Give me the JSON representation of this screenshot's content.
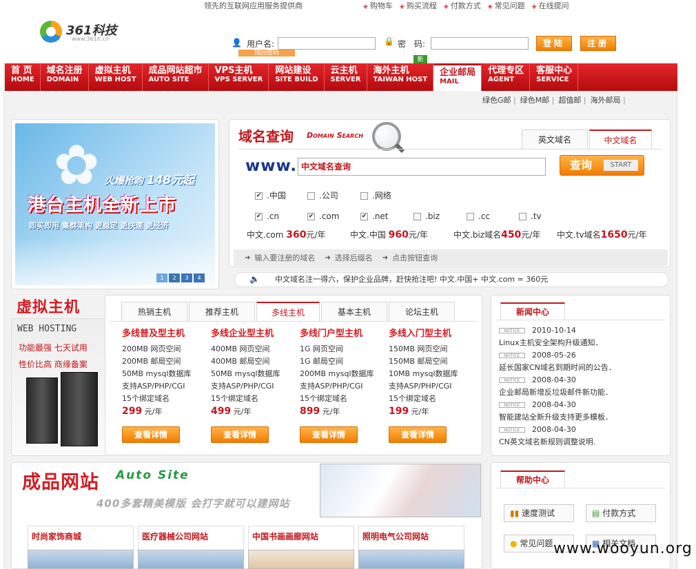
{
  "header": {
    "slogan": "领先的互联网应用服务提供商",
    "top_links": [
      "购物车",
      "购买流程",
      "付款方式",
      "常见问题",
      "在线提问"
    ],
    "logo_text": "361科技",
    "logo_sub": "www.361it.cn"
  },
  "login": {
    "username_label": "用户名:",
    "password_label": "密　码:",
    "login_button": "登陆",
    "register_button": "注册",
    "forgot_link": "找回密码",
    "new_badge": "新"
  },
  "nav": [
    {
      "cn": "首 页",
      "en": "HOME"
    },
    {
      "cn": "域名注册",
      "en": "DOMAIN"
    },
    {
      "cn": "虚拟主机",
      "en": "WEB HOST"
    },
    {
      "cn": "成品网站超市",
      "en": "AUTO SITE"
    },
    {
      "cn": "VPS主机",
      "en": "VPS SERVER"
    },
    {
      "cn": "网站建设",
      "en": "SITE BUILD"
    },
    {
      "cn": "云主机",
      "en": "SERVER"
    },
    {
      "cn": "海外主机",
      "en": "TAIWAN HOST"
    },
    {
      "cn": "企业邮局",
      "en": "MAIL"
    },
    {
      "cn": "代理专区",
      "en": "AGENT"
    },
    {
      "cn": "客服中心",
      "en": "SERVICE"
    }
  ],
  "subnav": [
    "绿色G邮",
    "绿色M邮",
    "超值邮",
    "海外邮局"
  ],
  "banner": {
    "promo": "火爆抢购",
    "price": "148元起",
    "headline": "港台主机全新上市",
    "tagline": "即买即用 集群架构 更稳定 更快速 更经济",
    "pages": [
      "1",
      "2",
      "3",
      "4"
    ]
  },
  "domain_search": {
    "title": "域名查询",
    "title_en": "Domain Search",
    "tabs": [
      "英文域名",
      "中文域名"
    ],
    "prefix": "www.",
    "input_value": "中文域名查询",
    "query_button": "查询",
    "start_label": "START",
    "row1": [
      {
        "label": ".中国",
        "checked": true
      },
      {
        "label": ".公司",
        "checked": false
      },
      {
        "label": ".网络",
        "checked": false
      }
    ],
    "row2": [
      {
        "label": ".cn",
        "checked": true
      },
      {
        "label": ".com",
        "checked": true
      },
      {
        "label": ".net",
        "checked": true
      },
      {
        "label": ".biz",
        "checked": false
      },
      {
        "label": ".cc",
        "checked": false
      },
      {
        "label": ".tv",
        "checked": false
      }
    ],
    "prices": [
      {
        "label": "中文.com",
        "value": "360",
        "unit": "元/年"
      },
      {
        "label": "中文.中国",
        "value": "960",
        "unit": "元/年"
      },
      {
        "label": "中文.biz域名",
        "value": "450",
        "unit": "元/年"
      },
      {
        "label": "中文.tv域名",
        "value": "1650",
        "unit": "元/年"
      }
    ],
    "steps": [
      "输入要注册的域名",
      "选择后缀名",
      "点击按钮查询"
    ],
    "notice": "中文域名注一得六，保护企业品牌，赶快抢注吧! 中文.中国+ 中文.com = 360元"
  },
  "hosting": {
    "title": "虚拟主机",
    "en": "WEB HOSTING",
    "tag1": "功能最强 七天试用",
    "tag2": "性价比高 商缘备案",
    "tabs": [
      "热销主机",
      "推荐主机",
      "多线主机",
      "基本主机",
      "论坛主机"
    ],
    "products": [
      {
        "title": "多线普及型主机",
        "lines": [
          "200MB 网页空间",
          "200MB 邮局空间",
          "50MB mysql数据库",
          "支持ASP/PHP/CGI",
          "15个绑定域名"
        ],
        "price": "299",
        "unit": "元/年",
        "button": "查看详情"
      },
      {
        "title": "多线企业型主机",
        "lines": [
          "400MB 网页空间",
          "400MB 邮局空间",
          "50MB mysql数据库",
          "支持ASP/PHP/CGI",
          "15个绑定域名"
        ],
        "price": "499",
        "unit": "元/年",
        "button": "查看详情"
      },
      {
        "title": "多线门户型主机",
        "lines": [
          "1G 网页空间",
          "1G 邮局空间",
          "200MB mysql数据库",
          "支持ASP/PHP/CGI",
          "15个绑定域名"
        ],
        "price": "899",
        "unit": "元/年",
        "button": "查看详情"
      },
      {
        "title": "多线入门型主机",
        "lines": [
          "150MB 网页空间",
          "150MB 邮局空间",
          "10MB mysql数据库",
          "支持ASP/PHP/CGI",
          "15个绑定域名"
        ],
        "price": "199",
        "unit": "元/年",
        "button": "查看详情"
      }
    ]
  },
  "news": {
    "title": "新闻中心",
    "tag": "NOTICE",
    "items": [
      {
        "date": "2010-10-14",
        "text": "Linux主机安全架构升级通知．"
      },
      {
        "date": "2008-05-26",
        "text": "延长国家CN域名到期时间的公告．"
      },
      {
        "date": "2008-04-30",
        "text": "企业邮局新增反垃圾邮件新功能．"
      },
      {
        "date": "2008-04-30",
        "text": "智能建站全新升级支持更多模板．"
      },
      {
        "date": "2008-04-30",
        "text": "CN英文域名新规则调整说明."
      }
    ]
  },
  "auto_site": {
    "title": "成品网站",
    "en": "Auto Site",
    "sub": "400多套精美模版 会打字就可以建网站",
    "cards": [
      "时尚家饰商城",
      "医疗器械公司网站",
      "中国书画画廊网站",
      "照明电气公司网站"
    ]
  },
  "help": {
    "title": "帮助中心",
    "buttons": [
      "速度测试",
      "付款方式",
      "常见问题",
      "相关文档"
    ]
  },
  "watermark": "www.wooyun.org"
}
